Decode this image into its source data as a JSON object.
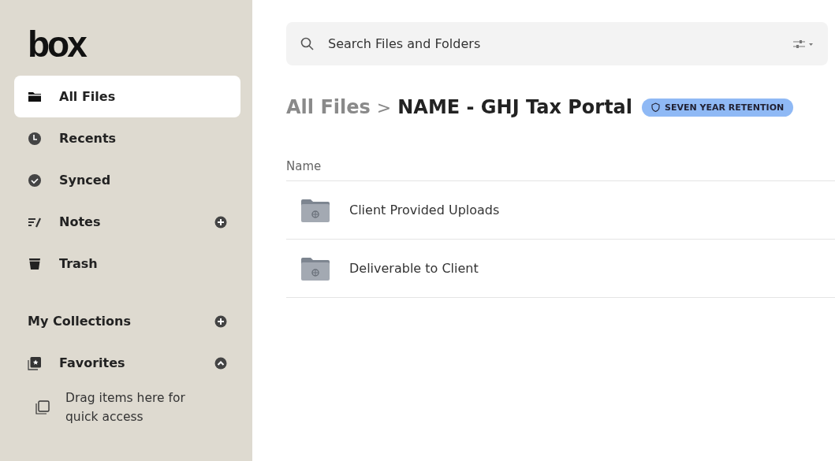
{
  "sidebar": {
    "logo": "box",
    "items": [
      {
        "label": "All Files",
        "kind": "folder",
        "selected": true
      },
      {
        "label": "Recents",
        "kind": "clock",
        "selected": false
      },
      {
        "label": "Synced",
        "kind": "check",
        "selected": false
      },
      {
        "label": "Notes",
        "kind": "notes",
        "selected": false,
        "add": true
      },
      {
        "label": "Trash",
        "kind": "trash",
        "selected": false
      }
    ],
    "collections": {
      "label": "My Collections",
      "favorites": {
        "label": "Favorites",
        "expanded": true,
        "hint": "Drag items here for quick access"
      }
    }
  },
  "search": {
    "placeholder": "Search Files and Folders"
  },
  "breadcrumb": {
    "parent": "All Files",
    "separator": ">",
    "current": "NAME - GHJ Tax Portal",
    "badge": "SEVEN YEAR RETENTION"
  },
  "table": {
    "columns": [
      "Name"
    ],
    "rows": [
      {
        "name": "Client Provided Uploads"
      },
      {
        "name": "Deliverable to Client"
      }
    ]
  }
}
